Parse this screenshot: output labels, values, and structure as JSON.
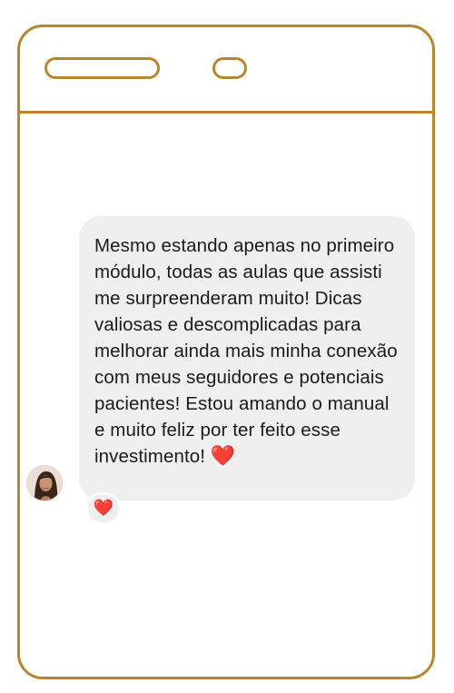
{
  "message": {
    "text": "Mesmo estando apenas no primeiro módulo, todas as aulas que assisti me surpreenderam muito! Dicas valiosas e descomplicadas para melhorar ainda mais minha conexão com meus seguidores e potenciais pacientes! Estou amando o manual e muito feliz por ter feito esse investimento!",
    "emoji": "❤️"
  },
  "reaction": {
    "emoji": "❤️"
  },
  "avatar": {
    "icon": "avatar"
  },
  "colors": {
    "frame": "#b8862b",
    "bubble": "#efefef",
    "heart": "#e0242f"
  }
}
